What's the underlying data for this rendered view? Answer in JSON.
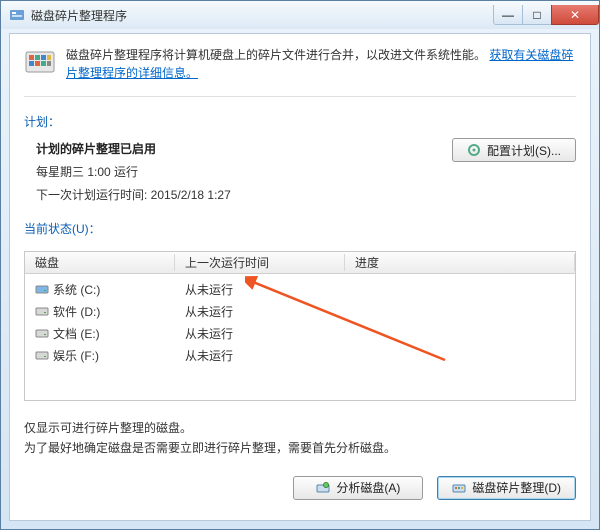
{
  "window": {
    "title": "磁盘碎片整理程序"
  },
  "winbtns": {
    "min": "—",
    "max": "□",
    "close": "✕"
  },
  "banner": {
    "text": "磁盘碎片整理程序将计算机硬盘上的碎片文件进行合并，以改进文件系统性能。",
    "link": "获取有关磁盘碎片整理程序的详细信息。"
  },
  "labels": {
    "plan": "计划：",
    "status": "当前状态(U)："
  },
  "plan": {
    "title": "计划的碎片整理已启用",
    "schedule": "每星期三 1:00 运行",
    "next_prefix": "下一次计划运行时间: ",
    "next_time": "2015/2/18 1:27",
    "config_btn": "配置计划(S)..."
  },
  "table": {
    "headers": {
      "disk": "磁盘",
      "last": "上一次运行时间",
      "progress": "进度"
    },
    "rows": [
      {
        "name": "系统 (C:)",
        "last": "从未运行",
        "icon": "sys"
      },
      {
        "name": "软件 (D:)",
        "last": "从未运行",
        "icon": "hdd"
      },
      {
        "name": "文档 (E:)",
        "last": "从未运行",
        "icon": "hdd"
      },
      {
        "name": "娱乐 (F:)",
        "last": "从未运行",
        "icon": "hdd"
      }
    ]
  },
  "note": {
    "line1": "仅显示可进行碎片整理的磁盘。",
    "line2": "为了最好地确定磁盘是否需要立即进行碎片整理，需要首先分析磁盘。"
  },
  "buttons": {
    "analyze": "分析磁盘(A)",
    "defrag": "磁盘碎片整理(D)"
  }
}
